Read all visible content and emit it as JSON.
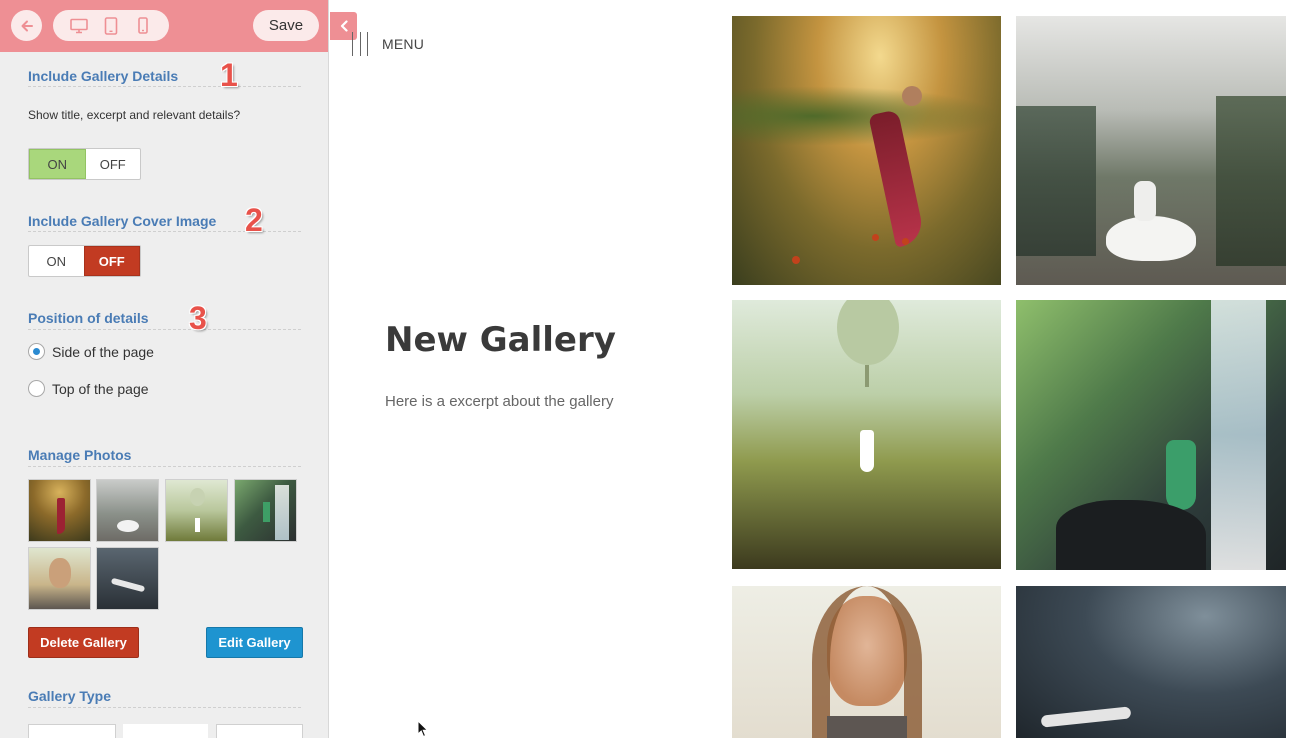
{
  "toolbar": {
    "back_icon": "arrow-left-icon",
    "device_icons": [
      "desktop-icon",
      "tablet-icon",
      "phone-icon"
    ],
    "save_label": "Save"
  },
  "sections": {
    "gallery_details": {
      "title": "Include Gallery Details",
      "step": "1",
      "description": "Show title, excerpt and relevant details?",
      "on_label": "ON",
      "off_label": "OFF",
      "selected": "ON"
    },
    "cover_image": {
      "title": "Include Gallery Cover Image",
      "step": "2",
      "on_label": "ON",
      "off_label": "OFF",
      "selected": "OFF"
    },
    "position": {
      "title": "Position of details",
      "step": "3",
      "options": [
        "Side of the page",
        "Top of the page"
      ],
      "selected": "Side of the page"
    },
    "manage_photos": {
      "title": "Manage Photos",
      "photo_count": 6
    },
    "gallery_type": {
      "title": "Gallery Type"
    }
  },
  "buttons": {
    "delete_label": "Delete Gallery",
    "edit_label": "Edit Gallery"
  },
  "main": {
    "menu_label": "MENU",
    "gallery_title": "New Gallery",
    "gallery_excerpt": "Here is a excerpt about the gallery"
  },
  "colors": {
    "topbar": "#ee8f94",
    "section_title": "#4a7cb5",
    "toggle_on": "#a9d77c",
    "toggle_off": "#c23b22",
    "delete_button": "#c23b22",
    "edit_button": "#1e94d0",
    "step_number": "#e8524a"
  }
}
